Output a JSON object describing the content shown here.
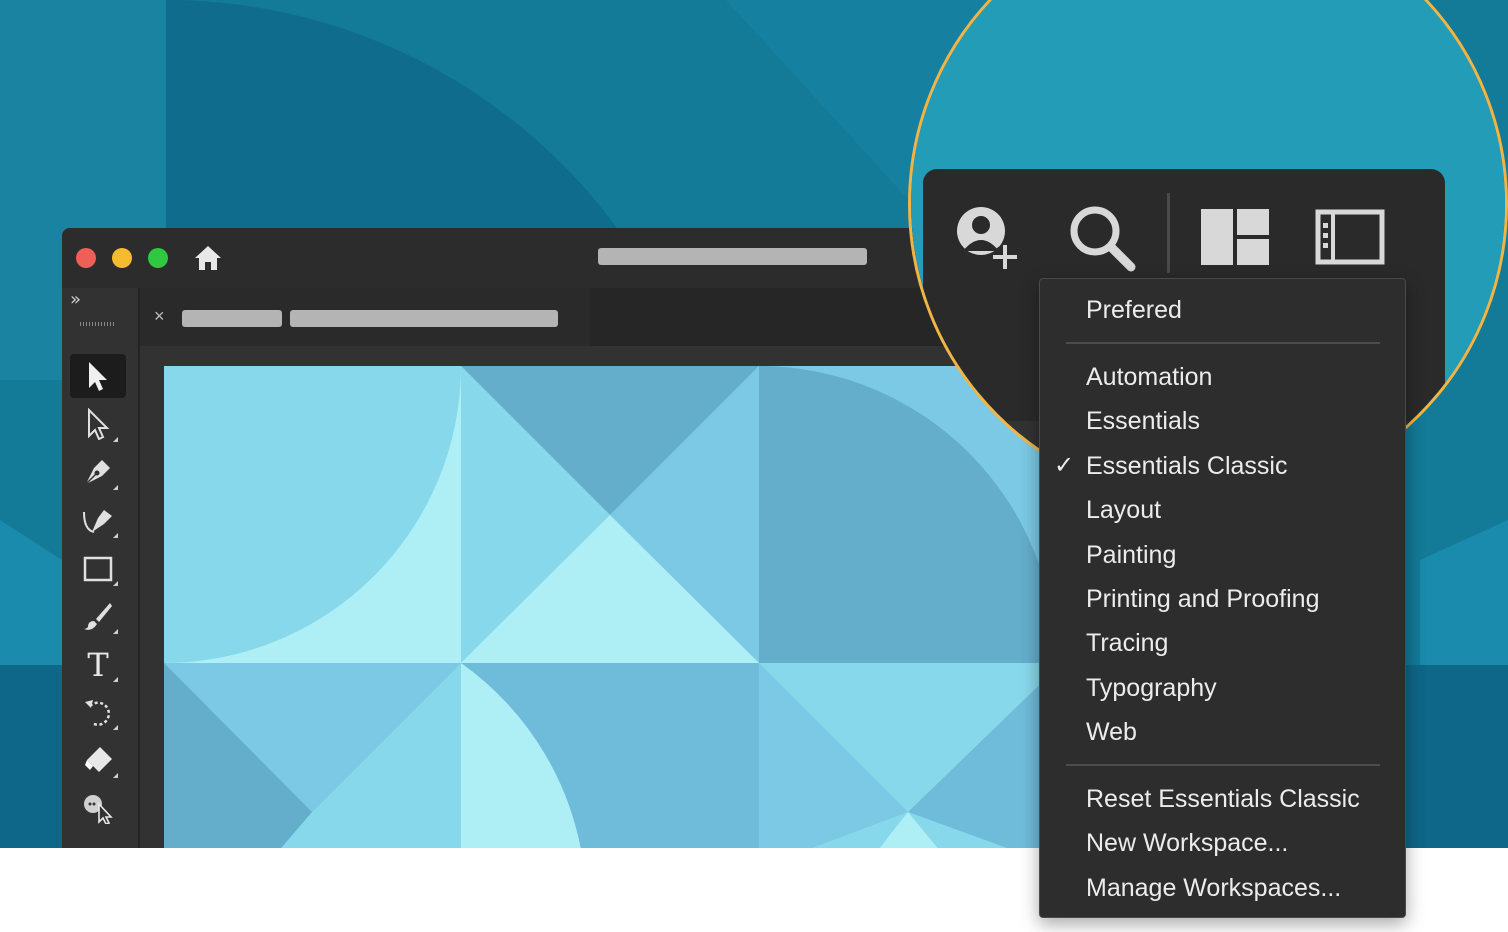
{
  "app": {
    "window_controls": [
      "close",
      "minimize",
      "zoom"
    ],
    "home_icon": "home-icon",
    "collapse_icon_glyph": "»",
    "tab_close_glyph": "×"
  },
  "tools": [
    {
      "name": "selection-tool-icon",
      "active": true
    },
    {
      "name": "direct-selection-tool-icon",
      "active": false
    },
    {
      "name": "pen-tool-icon",
      "active": false
    },
    {
      "name": "curvature-tool-icon",
      "active": false
    },
    {
      "name": "rectangle-tool-icon",
      "active": false
    },
    {
      "name": "paintbrush-tool-icon",
      "active": false
    },
    {
      "name": "type-tool-icon",
      "active": false
    },
    {
      "name": "rotate-tool-icon",
      "active": false
    },
    {
      "name": "eraser-tool-icon",
      "active": false
    },
    {
      "name": "shape-builder-tool-icon",
      "active": false
    }
  ],
  "type_tool_glyph": "T",
  "toolbar_icons": [
    "add-user-icon",
    "search-icon",
    "workspace-layout-icon",
    "panel-toggle-icon"
  ],
  "workspace_menu": {
    "top_item": "Prefered",
    "workspaces": [
      {
        "label": "Automation",
        "checked": false
      },
      {
        "label": "Essentials",
        "checked": false
      },
      {
        "label": "Essentials Classic",
        "checked": true
      },
      {
        "label": "Layout",
        "checked": false
      },
      {
        "label": "Painting",
        "checked": false
      },
      {
        "label": "Printing and Proofing",
        "checked": false
      },
      {
        "label": "Tracing",
        "checked": false
      },
      {
        "label": "Typography",
        "checked": false
      },
      {
        "label": "Web",
        "checked": false
      }
    ],
    "check_glyph": "✓",
    "actions": [
      "Reset Essentials Classic",
      "New Workspace...",
      "Manage Workspaces..."
    ]
  },
  "colors": {
    "background_teal": "#137a97",
    "zoom_ring": "#f2b443",
    "menu_bg": "#2d2d2d",
    "canvas_light": "#aeeff6",
    "canvas_mid": "#88d8ec",
    "canvas_dark": "#64aecb"
  }
}
